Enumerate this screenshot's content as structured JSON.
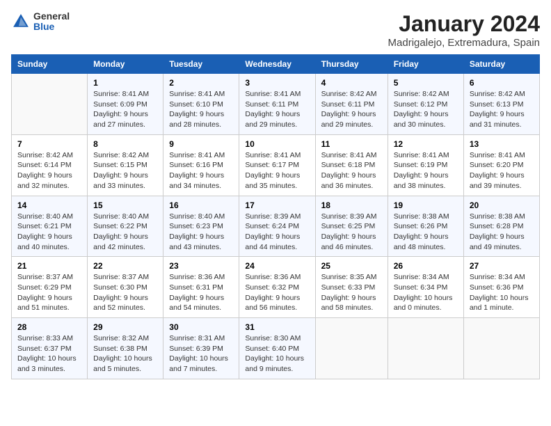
{
  "logo": {
    "general": "General",
    "blue": "Blue"
  },
  "title": "January 2024",
  "subtitle": "Madrigalejo, Extremadura, Spain",
  "days_of_week": [
    "Sunday",
    "Monday",
    "Tuesday",
    "Wednesday",
    "Thursday",
    "Friday",
    "Saturday"
  ],
  "weeks": [
    [
      {
        "day": "",
        "content": ""
      },
      {
        "day": "1",
        "content": "Sunrise: 8:41 AM\nSunset: 6:09 PM\nDaylight: 9 hours\nand 27 minutes."
      },
      {
        "day": "2",
        "content": "Sunrise: 8:41 AM\nSunset: 6:10 PM\nDaylight: 9 hours\nand 28 minutes."
      },
      {
        "day": "3",
        "content": "Sunrise: 8:41 AM\nSunset: 6:11 PM\nDaylight: 9 hours\nand 29 minutes."
      },
      {
        "day": "4",
        "content": "Sunrise: 8:42 AM\nSunset: 6:11 PM\nDaylight: 9 hours\nand 29 minutes."
      },
      {
        "day": "5",
        "content": "Sunrise: 8:42 AM\nSunset: 6:12 PM\nDaylight: 9 hours\nand 30 minutes."
      },
      {
        "day": "6",
        "content": "Sunrise: 8:42 AM\nSunset: 6:13 PM\nDaylight: 9 hours\nand 31 minutes."
      }
    ],
    [
      {
        "day": "7",
        "content": "Sunrise: 8:42 AM\nSunset: 6:14 PM\nDaylight: 9 hours\nand 32 minutes."
      },
      {
        "day": "8",
        "content": "Sunrise: 8:42 AM\nSunset: 6:15 PM\nDaylight: 9 hours\nand 33 minutes."
      },
      {
        "day": "9",
        "content": "Sunrise: 8:41 AM\nSunset: 6:16 PM\nDaylight: 9 hours\nand 34 minutes."
      },
      {
        "day": "10",
        "content": "Sunrise: 8:41 AM\nSunset: 6:17 PM\nDaylight: 9 hours\nand 35 minutes."
      },
      {
        "day": "11",
        "content": "Sunrise: 8:41 AM\nSunset: 6:18 PM\nDaylight: 9 hours\nand 36 minutes."
      },
      {
        "day": "12",
        "content": "Sunrise: 8:41 AM\nSunset: 6:19 PM\nDaylight: 9 hours\nand 38 minutes."
      },
      {
        "day": "13",
        "content": "Sunrise: 8:41 AM\nSunset: 6:20 PM\nDaylight: 9 hours\nand 39 minutes."
      }
    ],
    [
      {
        "day": "14",
        "content": "Sunrise: 8:40 AM\nSunset: 6:21 PM\nDaylight: 9 hours\nand 40 minutes."
      },
      {
        "day": "15",
        "content": "Sunrise: 8:40 AM\nSunset: 6:22 PM\nDaylight: 9 hours\nand 42 minutes."
      },
      {
        "day": "16",
        "content": "Sunrise: 8:40 AM\nSunset: 6:23 PM\nDaylight: 9 hours\nand 43 minutes."
      },
      {
        "day": "17",
        "content": "Sunrise: 8:39 AM\nSunset: 6:24 PM\nDaylight: 9 hours\nand 44 minutes."
      },
      {
        "day": "18",
        "content": "Sunrise: 8:39 AM\nSunset: 6:25 PM\nDaylight: 9 hours\nand 46 minutes."
      },
      {
        "day": "19",
        "content": "Sunrise: 8:38 AM\nSunset: 6:26 PM\nDaylight: 9 hours\nand 48 minutes."
      },
      {
        "day": "20",
        "content": "Sunrise: 8:38 AM\nSunset: 6:28 PM\nDaylight: 9 hours\nand 49 minutes."
      }
    ],
    [
      {
        "day": "21",
        "content": "Sunrise: 8:37 AM\nSunset: 6:29 PM\nDaylight: 9 hours\nand 51 minutes."
      },
      {
        "day": "22",
        "content": "Sunrise: 8:37 AM\nSunset: 6:30 PM\nDaylight: 9 hours\nand 52 minutes."
      },
      {
        "day": "23",
        "content": "Sunrise: 8:36 AM\nSunset: 6:31 PM\nDaylight: 9 hours\nand 54 minutes."
      },
      {
        "day": "24",
        "content": "Sunrise: 8:36 AM\nSunset: 6:32 PM\nDaylight: 9 hours\nand 56 minutes."
      },
      {
        "day": "25",
        "content": "Sunrise: 8:35 AM\nSunset: 6:33 PM\nDaylight: 9 hours\nand 58 minutes."
      },
      {
        "day": "26",
        "content": "Sunrise: 8:34 AM\nSunset: 6:34 PM\nDaylight: 10 hours\nand 0 minutes."
      },
      {
        "day": "27",
        "content": "Sunrise: 8:34 AM\nSunset: 6:36 PM\nDaylight: 10 hours\nand 1 minute."
      }
    ],
    [
      {
        "day": "28",
        "content": "Sunrise: 8:33 AM\nSunset: 6:37 PM\nDaylight: 10 hours\nand 3 minutes."
      },
      {
        "day": "29",
        "content": "Sunrise: 8:32 AM\nSunset: 6:38 PM\nDaylight: 10 hours\nand 5 minutes."
      },
      {
        "day": "30",
        "content": "Sunrise: 8:31 AM\nSunset: 6:39 PM\nDaylight: 10 hours\nand 7 minutes."
      },
      {
        "day": "31",
        "content": "Sunrise: 8:30 AM\nSunset: 6:40 PM\nDaylight: 10 hours\nand 9 minutes."
      },
      {
        "day": "",
        "content": ""
      },
      {
        "day": "",
        "content": ""
      },
      {
        "day": "",
        "content": ""
      }
    ]
  ]
}
